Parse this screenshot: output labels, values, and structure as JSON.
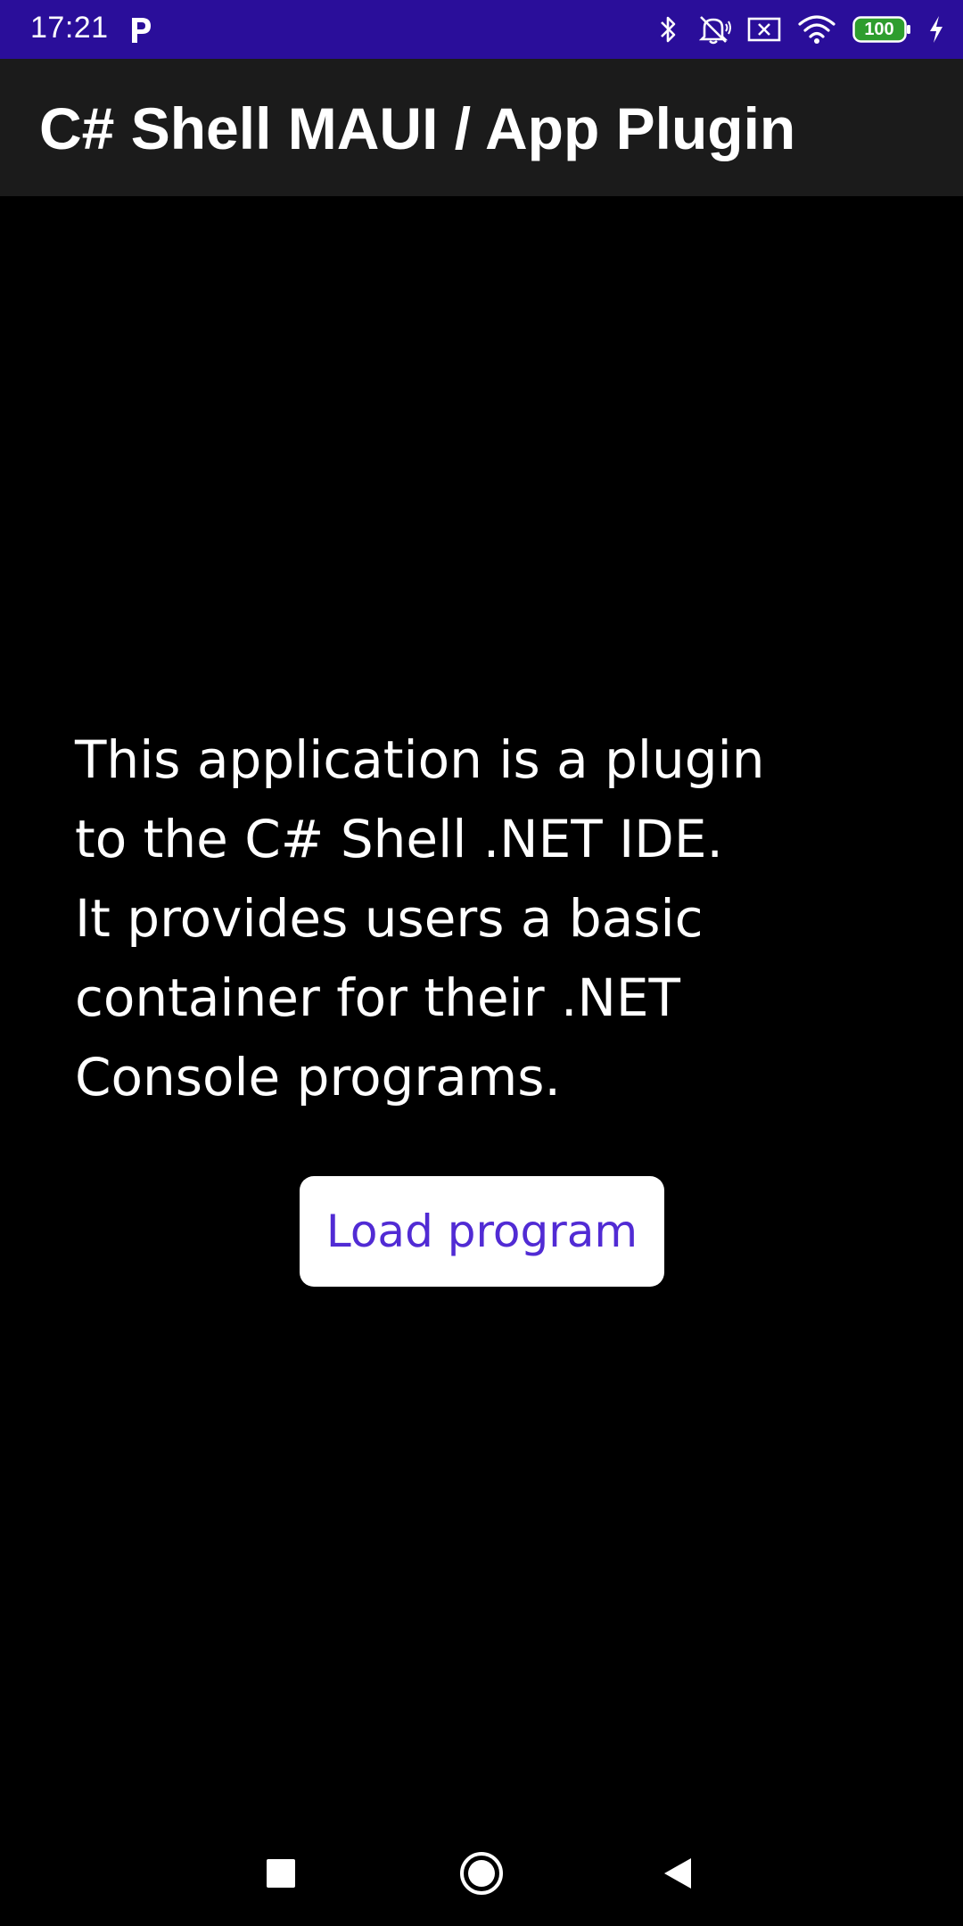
{
  "status_bar": {
    "time": "17:21",
    "battery_level": "100",
    "background_color": "#2a0e9a",
    "icons": [
      "parking-icon",
      "bluetooth-icon",
      "muted-bell-icon",
      "close-box-icon",
      "wifi-icon",
      "battery-icon",
      "charging-icon"
    ]
  },
  "app_bar": {
    "title": "C# Shell MAUI / App Plugin",
    "background_color": "#1b1b1b"
  },
  "main": {
    "description_lines": [
      "This application is a plugin",
      "to the C# Shell .NET IDE.",
      "It provides users a basic",
      "container for their .NET",
      "Console programs."
    ],
    "load_button_label": "Load program",
    "button_text_color": "#512bd4"
  },
  "nav_bar": {
    "buttons": [
      "recents-square-icon",
      "home-circle-icon",
      "back-triangle-icon"
    ]
  }
}
